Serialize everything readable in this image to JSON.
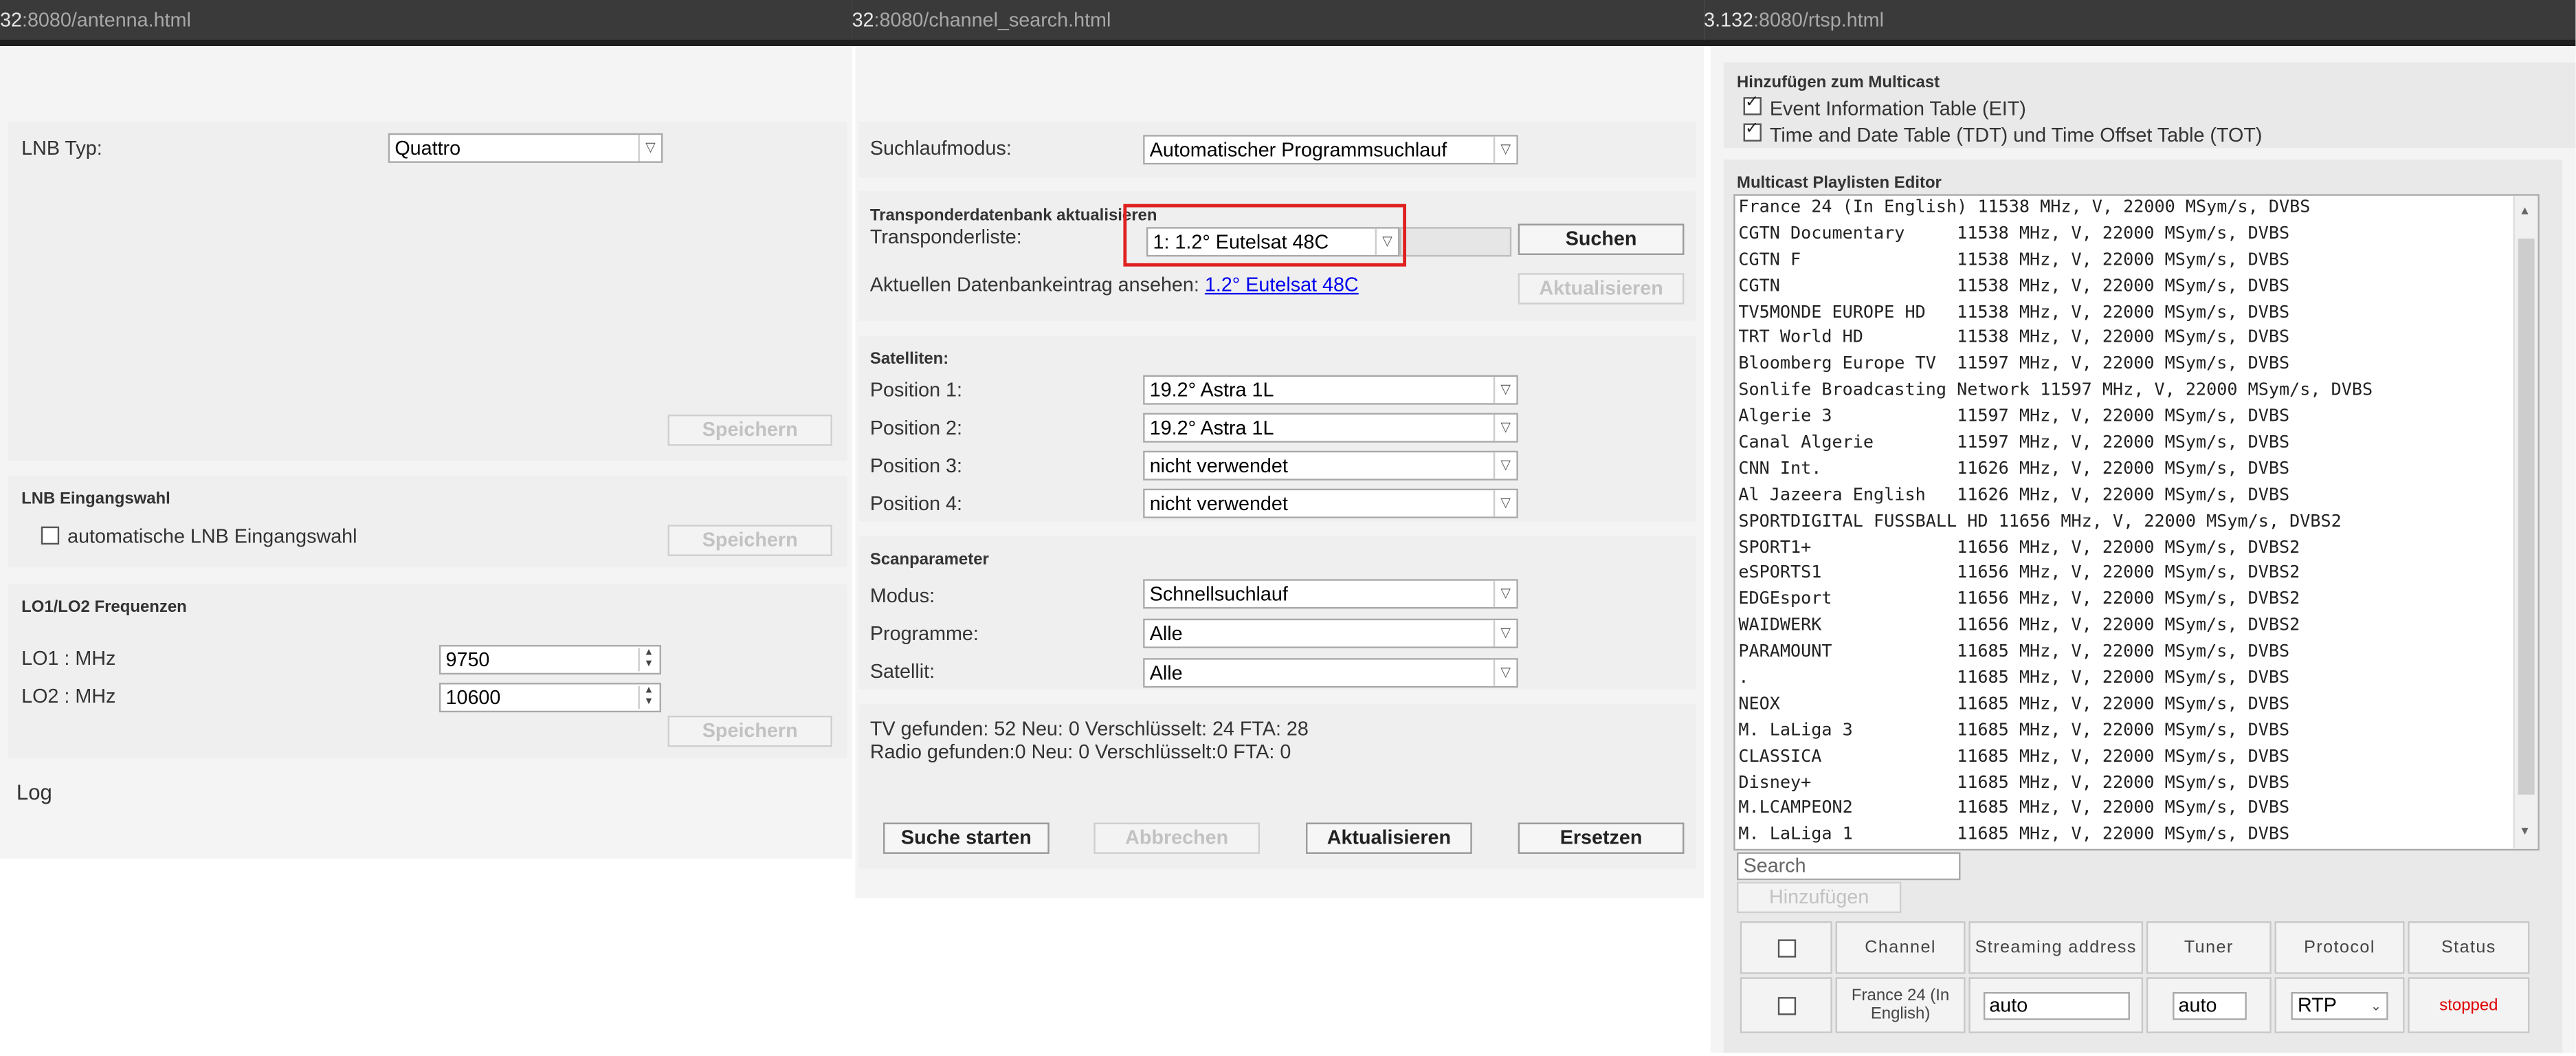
{
  "urls": {
    "left": {
      "host": "32",
      "path": ":8080/antenna.html"
    },
    "mid": {
      "host": "32",
      "path": ":8080/channel_search.html"
    },
    "right": {
      "host": "3.132",
      "path": ":8080/rtsp.html"
    }
  },
  "antenna": {
    "lnb_type_label": "LNB Typ:",
    "lnb_type_value": "Quattro",
    "save_label": "Speichern",
    "lnb_input_title": "LNB Eingangswahl",
    "auto_lnb_label": "automatische LNB Eingangswahl",
    "lo_title": "LO1/LO2 Frequenzen",
    "lo1_label": "LO1 : MHz",
    "lo1_value": "9750",
    "lo2_label": "LO2 : MHz",
    "lo2_value": "10600",
    "log_label": "Log"
  },
  "search": {
    "mode_label": "Suchlaufmodus:",
    "mode_value": "Automatischer Programmsuchlauf",
    "tp_title": "Transponderdatenbank aktualisieren",
    "tp_list_label": "Transponderliste:",
    "tp_list_value": "1: 1.2° Eutelsat 48C",
    "search_button": "Suchen",
    "db_entry_label": "Aktuellen Datenbankeintrag ansehen:",
    "db_entry_link": "1.2° Eutelsat 48C",
    "update_button": "Aktualisieren",
    "sat_title": "Satelliten:",
    "positions": [
      {
        "label": "Position 1:",
        "value": "19.2° Astra 1L"
      },
      {
        "label": "Position 2:",
        "value": "19.2° Astra 1L"
      },
      {
        "label": "Position 3:",
        "value": "nicht verwendet"
      },
      {
        "label": "Position 4:",
        "value": "nicht verwendet"
      }
    ],
    "scan_title": "Scanparameter",
    "scan_params": [
      {
        "label": "Modus:",
        "value": "Schnellsuchlauf"
      },
      {
        "label": "Programme:",
        "value": "Alle"
      },
      {
        "label": "Satellit:",
        "value": "Alle"
      }
    ],
    "result_tv": "TV gefunden: 52 Neu: 0 Verschlüsselt: 24 FTA: 28",
    "result_radio": "Radio gefunden:0 Neu: 0 Verschlüsselt:0 FTA: 0",
    "btn_start": "Suche starten",
    "btn_cancel": "Abbrechen",
    "btn_update": "Aktualisieren",
    "btn_replace": "Ersetzen"
  },
  "rtsp": {
    "multicast_title": "Hinzufügen zum Multicast",
    "eit_label": "Event Information Table (EIT)",
    "tdt_label": "Time and Date Table (TDT) und Time Offset Table (TOT)",
    "editor_title": "Multicast Playlisten Editor",
    "playlist": [
      "France 24 (In English) 11538 MHz, V, 22000 MSym/s, DVBS",
      "CGTN Documentary     11538 MHz, V, 22000 MSym/s, DVBS",
      "CGTN F               11538 MHz, V, 22000 MSym/s, DVBS",
      "CGTN                 11538 MHz, V, 22000 MSym/s, DVBS",
      "TV5MONDE EUROPE HD   11538 MHz, V, 22000 MSym/s, DVBS",
      "TRT World HD         11538 MHz, V, 22000 MSym/s, DVBS",
      "Bloomberg Europe TV  11597 MHz, V, 22000 MSym/s, DVBS",
      "Sonlife Broadcasting Network 11597 MHz, V, 22000 MSym/s, DVBS",
      "Algerie 3            11597 MHz, V, 22000 MSym/s, DVBS",
      "Canal Algerie        11597 MHz, V, 22000 MSym/s, DVBS",
      "CNN Int.             11626 MHz, V, 22000 MSym/s, DVBS",
      "Al Jazeera English   11626 MHz, V, 22000 MSym/s, DVBS",
      "SPORTDIGITAL FUSSBALL HD 11656 MHz, V, 22000 MSym/s, DVBS2",
      "SPORT1+              11656 MHz, V, 22000 MSym/s, DVBS2",
      "eSPORTS1             11656 MHz, V, 22000 MSym/s, DVBS2",
      "EDGEsport            11656 MHz, V, 22000 MSym/s, DVBS2",
      "WAIDWERK             11656 MHz, V, 22000 MSym/s, DVBS2",
      "PARAMOUNT            11685 MHz, V, 22000 MSym/s, DVBS",
      ".                    11685 MHz, V, 22000 MSym/s, DVBS",
      "NEOX                 11685 MHz, V, 22000 MSym/s, DVBS",
      "M. LaLiga 3          11685 MHz, V, 22000 MSym/s, DVBS",
      "CLASSICA             11685 MHz, V, 22000 MSym/s, DVBS",
      "Disney+              11685 MHz, V, 22000 MSym/s, DVBS",
      "M.LCAMPEON2          11685 MHz, V, 22000 MSym/s, DVBS",
      "M. LaLiga 1          11685 MHz, V, 22000 MSym/s, DVBS"
    ],
    "search_placeholder": "Search",
    "add_button": "Hinzufügen",
    "table": {
      "headers": [
        "Channel",
        "Streaming address",
        "Tuner",
        "Protocol",
        "Status"
      ],
      "row": {
        "channel": "France 24 (In English)",
        "address": "auto",
        "tuner": "auto",
        "protocol": "RTP",
        "status": "stopped"
      }
    },
    "status_color": "#e00000"
  },
  "highlight_color": "#e02020"
}
